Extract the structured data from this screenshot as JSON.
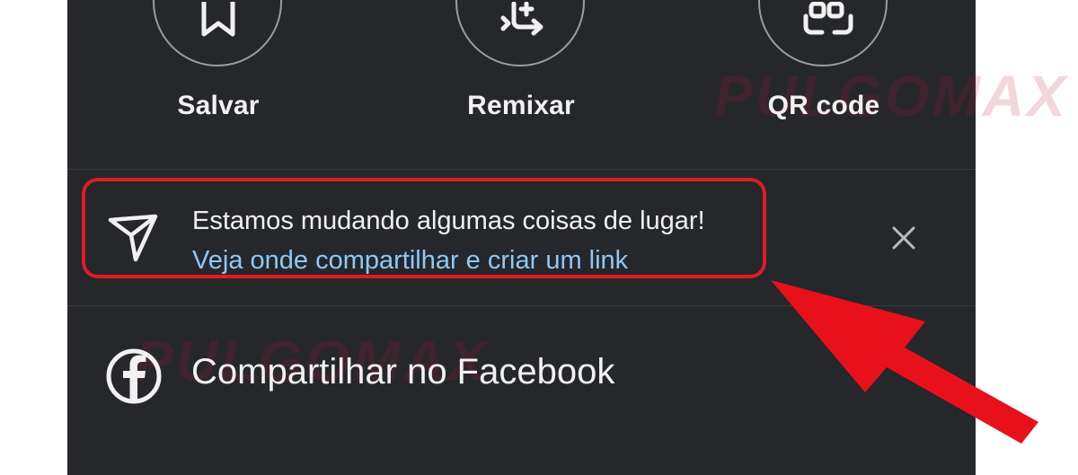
{
  "actions": {
    "save_label": "Salvar",
    "remix_label": "Remixar",
    "qr_label": "QR code"
  },
  "notice": {
    "message": "Estamos mudando algumas coisas de lugar!",
    "link": "Veja onde compartilhar e criar um link"
  },
  "share": {
    "facebook_label": "Compartilhar no Facebook"
  },
  "watermark": {
    "text": "PULGOMAX"
  },
  "colors": {
    "panel_bg": "#25272b",
    "text": "#f1f1f1",
    "link": "#8fc8f5",
    "highlight": "#e11b24"
  }
}
